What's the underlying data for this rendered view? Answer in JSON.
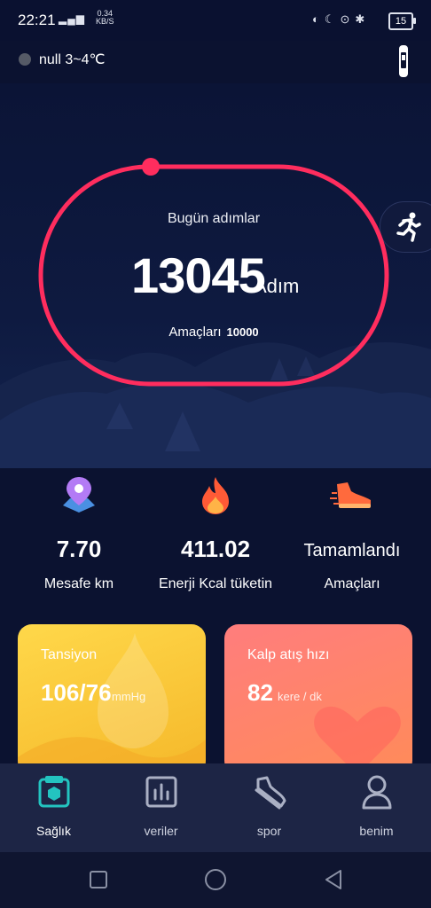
{
  "status_bar": {
    "time": "22:21",
    "network": "4G",
    "speed_value": "0.34",
    "speed_unit": "KB/S",
    "battery": "15"
  },
  "weather": {
    "text": "null 3~4℃"
  },
  "steps": {
    "title": "Bugün adımlar",
    "count": "13045",
    "unit": "Adım",
    "goal_label": "Amaçları",
    "goal_value": "10000",
    "progress": 1.0,
    "ring_color": "#ff2d5e"
  },
  "stats": [
    {
      "value": "7.70",
      "label": "Mesafe km",
      "icon": "location-pin-icon"
    },
    {
      "value": "411.02",
      "label": "Enerji Kcal tüketin",
      "icon": "flame-icon"
    },
    {
      "value": "Tamamlandı",
      "label": "Amaçları",
      "icon": "running-shoe-icon"
    }
  ],
  "cards": {
    "blood_pressure": {
      "title": "Tansiyon",
      "value": "106/76",
      "unit": "mmHg",
      "color": "#ffd84a"
    },
    "heart_rate": {
      "title": "Kalp atış hızı",
      "value": "82",
      "unit": "kere / dk",
      "color": "#ff7d7d"
    }
  },
  "tabs": [
    {
      "label": "Sağlık",
      "icon": "health-scale-icon",
      "active": true
    },
    {
      "label": "veriler",
      "icon": "chart-icon",
      "active": false
    },
    {
      "label": "spor",
      "icon": "shoe-icon",
      "active": false
    },
    {
      "label": "benim",
      "icon": "person-icon",
      "active": false
    }
  ],
  "colors": {
    "accent": "#23c4c0",
    "background": "#0b1230"
  }
}
